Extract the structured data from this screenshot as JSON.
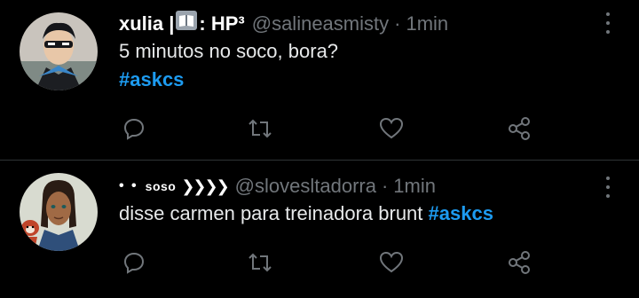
{
  "tweets": [
    {
      "name_part1": "xulia |",
      "name_part2": ": HP³",
      "handle": "@salineasmisty",
      "separator": "·",
      "time": "1min",
      "text": "5 minutos no soco, bora?",
      "hashtag": "#askcs"
    },
    {
      "name_deco": "• •",
      "name": "soso",
      "name_chevrons": "❯❯❯❯",
      "handle": "@slovesltadorra",
      "separator": "·",
      "time": "1min",
      "text": "disse carmen para treinadora brunt ",
      "hashtag": "#askcs"
    }
  ],
  "icons": [
    "reply-icon",
    "retweet-icon",
    "like-icon",
    "share-icon",
    "more-icon"
  ],
  "colors": {
    "background": "#000000",
    "text": "#e7e9ea",
    "muted": "#71767b",
    "link": "#1d9bf0",
    "divider": "#2f3336"
  }
}
